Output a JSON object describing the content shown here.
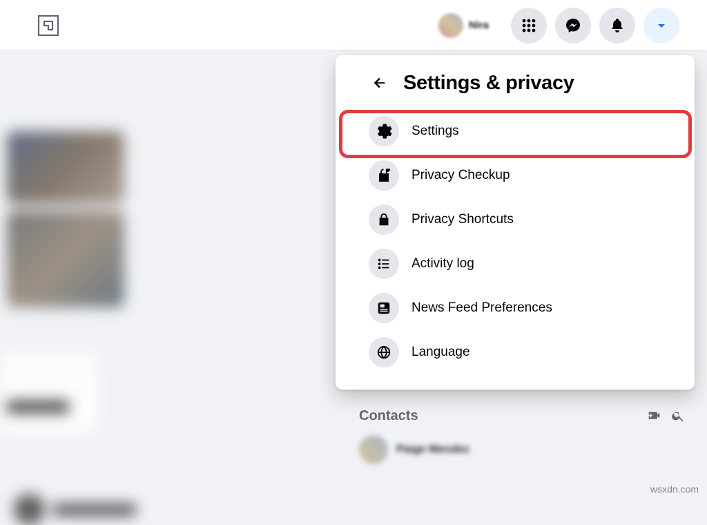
{
  "header": {
    "profile_name": "Nira"
  },
  "dropdown": {
    "title": "Settings & privacy",
    "items": [
      {
        "icon": "gear-icon",
        "label": "Settings",
        "highlighted": true
      },
      {
        "icon": "lock-heart-icon",
        "label": "Privacy Checkup"
      },
      {
        "icon": "lock-icon",
        "label": "Privacy Shortcuts"
      },
      {
        "icon": "list-icon",
        "label": "Activity log"
      },
      {
        "icon": "feed-icon",
        "label": "News Feed Preferences"
      },
      {
        "icon": "globe-icon",
        "label": "Language"
      }
    ]
  },
  "contacts": {
    "header": "Contacts"
  },
  "watermark": "wsxdn.com"
}
